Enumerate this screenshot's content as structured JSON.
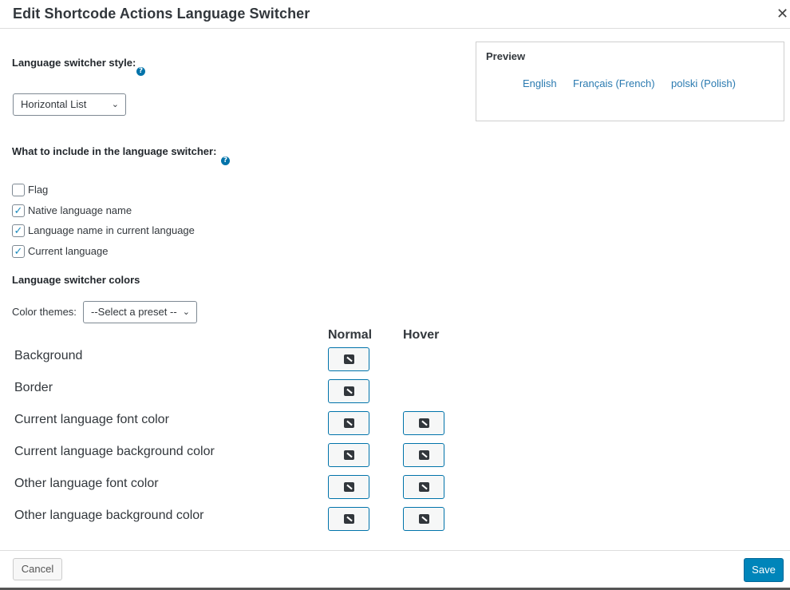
{
  "dialog": {
    "title": "Edit Shortcode Actions Language Switcher",
    "close_glyph": "✕"
  },
  "style_section": {
    "label": "Language switcher style:",
    "help_glyph": "?",
    "selected": "Horizontal List"
  },
  "include_section": {
    "label": "What to include in the language switcher:",
    "help_glyph": "?",
    "options": [
      {
        "label": "Flag",
        "checked": false
      },
      {
        "label": "Native language name",
        "checked": true
      },
      {
        "label": "Language name in current language",
        "checked": true
      },
      {
        "label": "Current language",
        "checked": true
      }
    ]
  },
  "colors_section": {
    "label": "Language switcher colors",
    "themes_label": "Color themes:",
    "themes_selected": "--Select a preset --",
    "col_normal": "Normal",
    "col_hover": "Hover",
    "rows": [
      {
        "label": "Background",
        "has_hover": false
      },
      {
        "label": "Border",
        "has_hover": false
      },
      {
        "label": "Current language font color",
        "has_hover": true
      },
      {
        "label": "Current language background color",
        "has_hover": true
      },
      {
        "label": "Other language font color",
        "has_hover": true
      },
      {
        "label": "Other language background color",
        "has_hover": true
      }
    ]
  },
  "preview": {
    "title": "Preview",
    "links": [
      "English",
      "Français (French)",
      "polski (Polish)"
    ]
  },
  "footer": {
    "cancel_label": "Cancel",
    "save_label": "Save"
  },
  "icons": {
    "color_picker": "color-picker-icon",
    "check": "checkmark-icon",
    "help": "help-icon",
    "chevron": "chevron-down-icon",
    "close": "close-icon"
  },
  "colors": {
    "accent": "#0073aa",
    "save_button": "#0085ba",
    "link": "#2a7ab0"
  }
}
